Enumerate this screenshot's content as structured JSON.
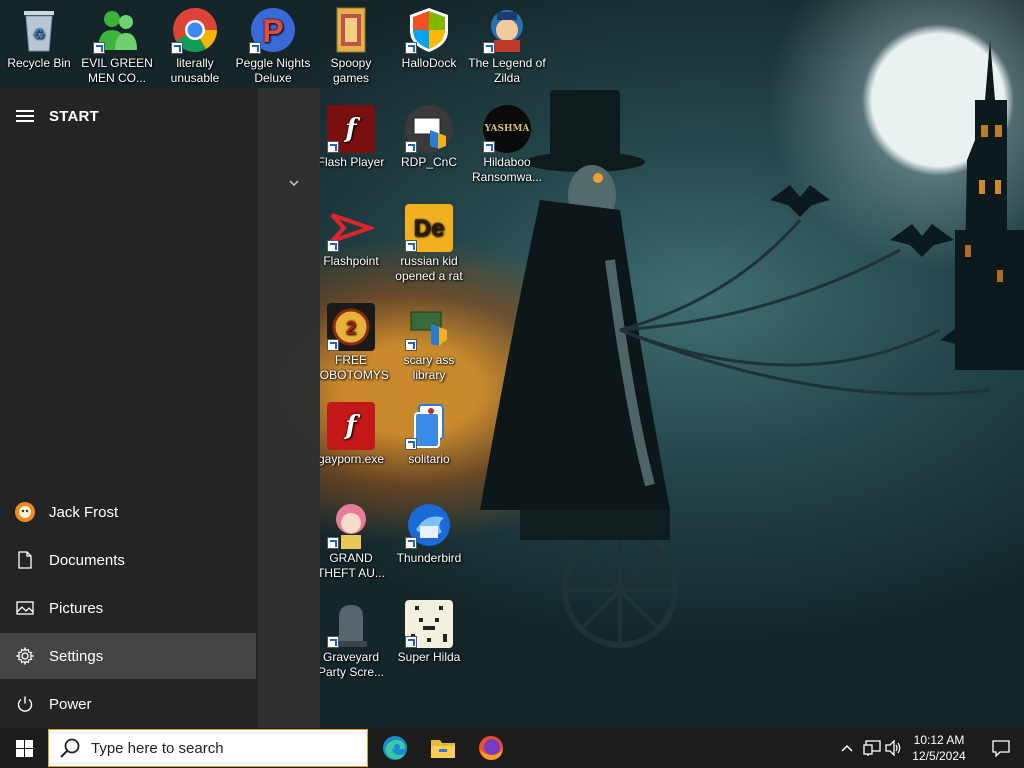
{
  "desktop": {
    "icons": [
      {
        "label": "Recycle Bin"
      },
      {
        "label": "EVIL GREEN MEN CO..."
      },
      {
        "label": "literally unusable"
      },
      {
        "label": "Peggle Nights Deluxe"
      },
      {
        "label": "Spoopy games"
      },
      {
        "label": "HalloDock"
      },
      {
        "label": "The Legend of Zilda"
      },
      {
        "label": "Flash Player"
      },
      {
        "label": "RDP_CnC"
      },
      {
        "label": "Hildaboo Ransomwa..."
      },
      {
        "label": "Flashpoint"
      },
      {
        "label": "russian kid opened a rat"
      },
      {
        "label": "FREE LOBOTOMYS"
      },
      {
        "label": "scary ass library"
      },
      {
        "label": "gayporn.exe"
      },
      {
        "label": "solitario"
      },
      {
        "label": "GRAND THEFT AU..."
      },
      {
        "label": "Thunderbird"
      },
      {
        "label": "Graveyard Party Scre..."
      },
      {
        "label": "Super Hilda"
      }
    ],
    "icon_glyphs": {
      "flash": "f",
      "rdp_overlay": "",
      "hildaboo_text": "YASHMA",
      "russian_kid": "De"
    }
  },
  "start_menu": {
    "title": "START",
    "items": [
      {
        "label": "Jack Frost",
        "icon": "user-avatar"
      },
      {
        "label": "Documents",
        "icon": "document-icon"
      },
      {
        "label": "Pictures",
        "icon": "pictures-icon"
      },
      {
        "label": "Settings",
        "icon": "gear-icon"
      },
      {
        "label": "Power",
        "icon": "power-icon"
      }
    ]
  },
  "taskbar": {
    "search_placeholder": "Type here to search",
    "pinned": [
      "Microsoft Edge",
      "File Explorer",
      "Firefox"
    ],
    "clock_time": "10:12 AM",
    "clock_date": "12/5/2024"
  },
  "colors": {
    "taskbar": "#1c1c1c",
    "start_rail": "#242424",
    "search_border": "#e0a21a",
    "selected_item": "#444444"
  }
}
